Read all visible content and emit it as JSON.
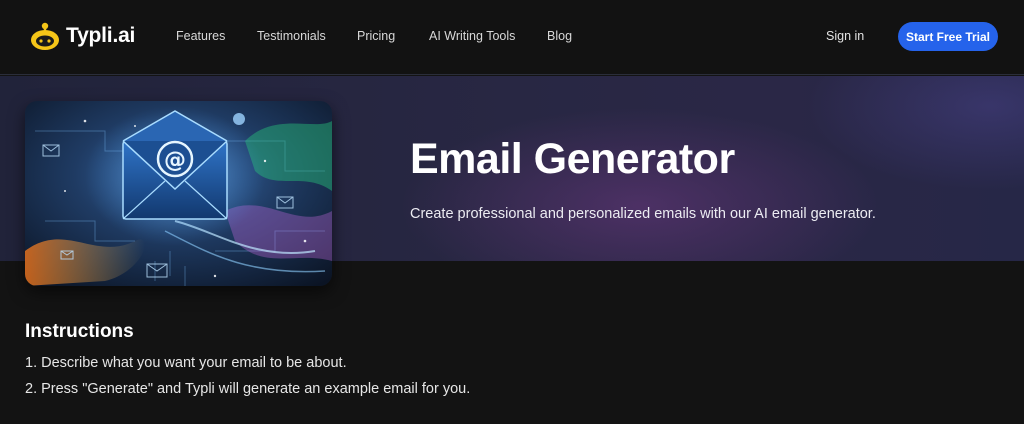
{
  "brand": {
    "name": "Typli.ai",
    "accent": "#2563eb",
    "logo_color": "#f5c518"
  },
  "nav": {
    "links": [
      "Features",
      "Testimonials",
      "Pricing",
      "AI Writing Tools",
      "Blog"
    ],
    "signin": "Sign in",
    "cta": "Start Free Trial"
  },
  "hero": {
    "title": "Email Generator",
    "subtitle": "Create professional and personalized emails with our AI email generator.",
    "image_icon": "email-envelope-icon"
  },
  "instructions": {
    "title": "Instructions",
    "items": [
      "1. Describe what you want your email to be about.",
      "2. Press \"Generate\" and Typli will generate an example email for you."
    ]
  }
}
